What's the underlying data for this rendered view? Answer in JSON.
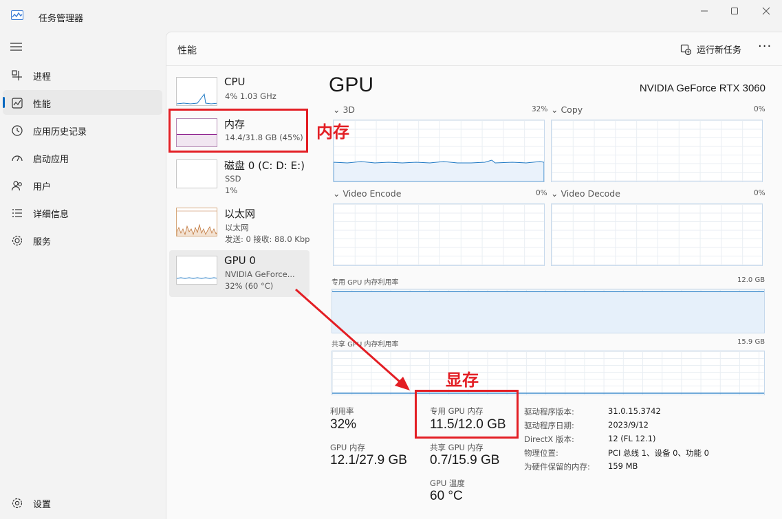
{
  "window": {
    "title": "任务管理器"
  },
  "nav": {
    "items": [
      {
        "label": "进程",
        "icon": "grid-icon"
      },
      {
        "label": "性能",
        "icon": "performance-icon",
        "active": true
      },
      {
        "label": "应用历史记录",
        "icon": "history-icon"
      },
      {
        "label": "启动应用",
        "icon": "speedometer-icon"
      },
      {
        "label": "用户",
        "icon": "users-icon"
      },
      {
        "label": "详细信息",
        "icon": "list-icon"
      },
      {
        "label": "服务",
        "icon": "gear-icon"
      }
    ],
    "settings_label": "设置"
  },
  "header": {
    "title": "性能",
    "run_task_label": "运行新任务",
    "more": "···"
  },
  "devices": [
    {
      "name": "CPU",
      "lines": [
        "4% 1.03 GHz"
      ]
    },
    {
      "name": "内存",
      "lines": [
        "14.4/31.8 GB (45%)"
      ]
    },
    {
      "name": "磁盘 0 (C: D: E:)",
      "lines": [
        "SSD",
        "1%"
      ]
    },
    {
      "name": "以太网",
      "lines": [
        "以太网",
        "发送: 0 接收: 88.0 Kbp"
      ]
    },
    {
      "name": "GPU 0",
      "lines": [
        "NVIDIA GeForce...",
        "32% (60 °C)"
      ]
    }
  ],
  "gpu": {
    "title": "GPU",
    "model": "NVIDIA GeForce RTX 3060",
    "engines": [
      {
        "name": "3D",
        "percent": "32%"
      },
      {
        "name": "Copy",
        "percent": "0%"
      },
      {
        "name": "Video Encode",
        "percent": "0%"
      },
      {
        "name": "Video Decode",
        "percent": "0%"
      }
    ],
    "dedicated_graph": {
      "label": "专用 GPU 内存利用率",
      "max": "12.0 GB"
    },
    "shared_graph": {
      "label": "共享 GPU 内存利用率",
      "max": "15.9 GB"
    },
    "stats": {
      "utilization_label": "利用率",
      "utilization_value": "32%",
      "dedicated_label": "专用 GPU 内存",
      "dedicated_value": "11.5/12.0 GB",
      "gpu_mem_label": "GPU 内存",
      "gpu_mem_value": "12.1/27.9 GB",
      "shared_label": "共享 GPU 内存",
      "shared_value": "0.7/15.9 GB",
      "temp_label": "GPU 温度",
      "temp_value": "60 °C"
    },
    "info": [
      {
        "key": "驱动程序版本:",
        "value": "31.0.15.3742"
      },
      {
        "key": "驱动程序日期:",
        "value": "2023/9/12"
      },
      {
        "key": "DirectX 版本:",
        "value": "12 (FL 12.1)"
      },
      {
        "key": "物理位置:",
        "value": "PCI 总线 1、设备 0、功能 0"
      },
      {
        "key": "为硬件保留的内存:",
        "value": "159 MB"
      }
    ]
  },
  "annotations": {
    "memory_label": "内存",
    "vram_label": "显存"
  },
  "colors": {
    "accent": "#0067c0",
    "annotation": "#e31e24",
    "memory": "#8b1a8b",
    "ethernet": "#c0763a",
    "graph_line": "#1f79c4"
  }
}
